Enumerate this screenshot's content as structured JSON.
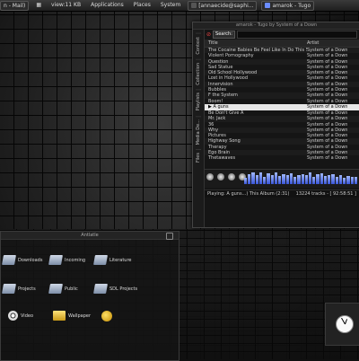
{
  "panel": {
    "left_task": "n - Mail)",
    "workspace_label": "view:11 KB",
    "menus": [
      "Applications",
      "Places",
      "System"
    ],
    "terminal_task": "[annaecide@saphi...",
    "amarok_task": "amarok - Tugo"
  },
  "amarok": {
    "window_title": "amarok - Tugo by System of a Down",
    "side_tabs": [
      "Context",
      "Collection",
      "Playlists",
      "Media De...",
      "Files"
    ],
    "search_label": "Search:",
    "columns": {
      "title": "Title",
      "artist": "Artist"
    },
    "tracks": [
      {
        "title": "The Cocaine Babies Be Feel Like In Do This So...",
        "artist": "System of a Down"
      },
      {
        "title": "Violent Pornography",
        "artist": "System of a Down"
      },
      {
        "title": "Question",
        "artist": "System of a Down"
      },
      {
        "title": "Sad Statue",
        "artist": "System of a Down"
      },
      {
        "title": "Old School Hollywood",
        "artist": "System of a Down"
      },
      {
        "title": "Lost in Hollywood",
        "artist": "System of a Down"
      },
      {
        "title": "Innervision",
        "artist": "System of a Down"
      },
      {
        "title": "Bubbles",
        "artist": "System of a Down"
      },
      {
        "title": "F the System",
        "artist": "System of a Down"
      },
      {
        "title": "Boom!",
        "artist": "System of a Down"
      },
      {
        "title": "A guns",
        "artist": "System of a Down",
        "playing": true
      },
      {
        "title": "Be Don't Give A",
        "artist": "System of a Down"
      },
      {
        "title": "Mr. Jack",
        "artist": "System of a Down"
      },
      {
        "title": "36",
        "artist": "System of a Down"
      },
      {
        "title": "Why",
        "artist": "System of a Down"
      },
      {
        "title": "Pictures",
        "artist": "System of a Down"
      },
      {
        "title": "Highway Song",
        "artist": "System of a Down"
      },
      {
        "title": "Therapy",
        "artist": "System of a Down"
      },
      {
        "title": "Ego Brain",
        "artist": "System of a Down"
      },
      {
        "title": "Thetawaves",
        "artist": "System of a Down"
      }
    ],
    "spectrum_levels": [
      0.5,
      0.8,
      0.9,
      0.7,
      0.95,
      0.6,
      0.85,
      0.75,
      0.9,
      0.65,
      0.8,
      0.7,
      0.88,
      0.6,
      0.75,
      0.82,
      0.7,
      0.9,
      0.6,
      0.78,
      0.85,
      0.66,
      0.72,
      0.8,
      0.6,
      0.7,
      0.5,
      0.65,
      0.55,
      0.6
    ],
    "status_playing": "Playing: A guns...) This Album (2:31)",
    "status_tracks": "13224 tracks - [ 92:58:51 ]"
  },
  "file_manager": {
    "title": "Antlatle",
    "items": [
      {
        "label": "Downloads",
        "icon": "folder-icon"
      },
      {
        "label": "Incoming",
        "icon": "folder-icon"
      },
      {
        "label": "Literature",
        "icon": "folder-icon"
      },
      {
        "label": "Projects",
        "icon": "folder-icon"
      },
      {
        "label": "Public",
        "icon": "folder-icon"
      },
      {
        "label": "SDL Projects",
        "icon": "folder-icon"
      },
      {
        "label": "Video",
        "icon": "film-reel-icon"
      },
      {
        "label": "Wallpaper",
        "icon": "folder-icon"
      },
      {
        "label": "",
        "icon": "home-icon"
      }
    ]
  },
  "colors": {
    "accent": "#3a56d8",
    "selection": "#e6e6e6"
  }
}
